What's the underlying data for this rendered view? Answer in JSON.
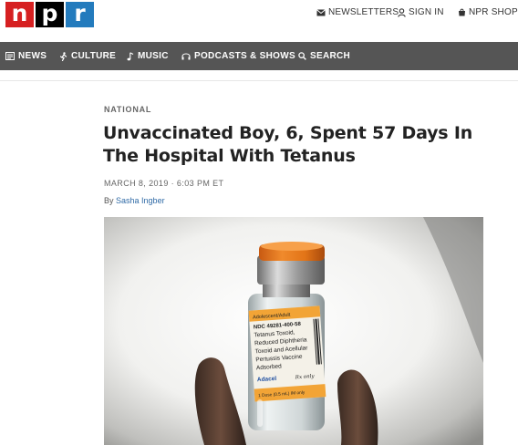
{
  "header": {
    "logo_letters": [
      "n",
      "p",
      "r"
    ],
    "logo_colors": [
      "#d62021",
      "#000000",
      "#237bbd"
    ],
    "utility_links": [
      "NEWSLETTERS",
      "SIGN IN",
      "NPR SHOP"
    ]
  },
  "nav": {
    "items": [
      {
        "label": "NEWS",
        "icon": "news-icon"
      },
      {
        "label": "CULTURE",
        "icon": "culture-icon"
      },
      {
        "label": "MUSIC",
        "icon": "music-note-icon"
      },
      {
        "label": "PODCASTS & SHOWS",
        "icon": "headphones-icon"
      },
      {
        "label": "SEARCH",
        "icon": "search-icon"
      }
    ],
    "background": "#555555"
  },
  "article": {
    "section": "NATIONAL",
    "headline": "Unvaccinated Boy, 6, Spent 57 Days In The Hospital With Tetanus",
    "date": "MARCH 8, 2019 · 6:03 PM ET",
    "byline_prefix": "By",
    "author": "Sasha Ingber"
  },
  "photo": {
    "label_lines": [
      "Adolescent/Adult",
      "NDC 49281-400-58",
      "Tetanus Toxoid,",
      "Reduced Diphtheria",
      "Toxoid and Acellular",
      "Pertussis Vaccine",
      "Adsorbed",
      "Adacel"
    ],
    "rx_text": "Rx only",
    "bottom_text": "1 Dose (0.5 mL)  IM only"
  }
}
